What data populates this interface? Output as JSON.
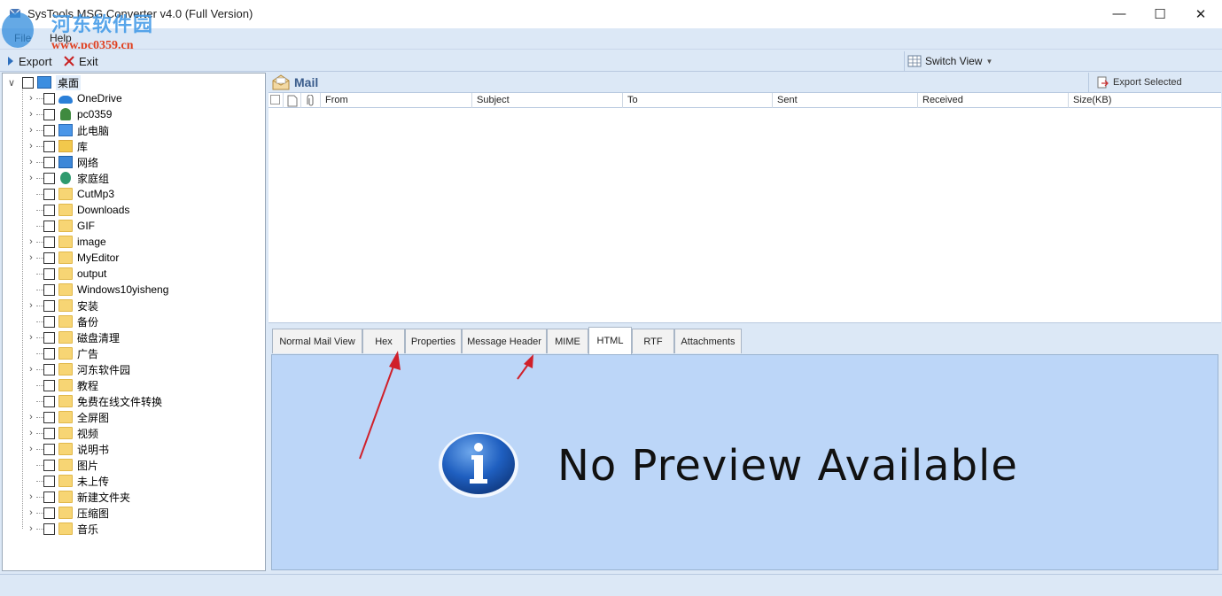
{
  "window": {
    "title": "SysTools MSG Converter v4.0 (Full Version)",
    "minimize": "—",
    "maximize": "☐",
    "close": "✕"
  },
  "watermark": {
    "site_name": "河东软件园",
    "url": "www.pc0359.cn"
  },
  "menu": {
    "file": "File",
    "help": "Help"
  },
  "toolbar": {
    "export": "Export",
    "exit": "Exit",
    "switch_view": "Switch View"
  },
  "tree": {
    "root": "桌面",
    "items": [
      {
        "label": "OneDrive",
        "icon": "onedrive-icon",
        "expandable": true
      },
      {
        "label": "pc0359",
        "icon": "user-icon",
        "expandable": true
      },
      {
        "label": "此电脑",
        "icon": "computer-icon",
        "expandable": true
      },
      {
        "label": "库",
        "icon": "library-icon",
        "expandable": true
      },
      {
        "label": "网络",
        "icon": "network-icon",
        "expandable": true
      },
      {
        "label": "家庭组",
        "icon": "homegroup-icon",
        "expandable": true
      },
      {
        "label": "CutMp3",
        "icon": "folder-icon",
        "expandable": false
      },
      {
        "label": "Downloads",
        "icon": "folder-icon",
        "expandable": false
      },
      {
        "label": "GIF",
        "icon": "folder-icon",
        "expandable": false
      },
      {
        "label": "image",
        "icon": "folder-icon",
        "expandable": true
      },
      {
        "label": "MyEditor",
        "icon": "folder-icon",
        "expandable": true
      },
      {
        "label": "output",
        "icon": "folder-icon",
        "expandable": false
      },
      {
        "label": "Windows10yisheng",
        "icon": "folder-icon",
        "expandable": false
      },
      {
        "label": "安装",
        "icon": "folder-icon",
        "expandable": true
      },
      {
        "label": "备份",
        "icon": "folder-icon",
        "expandable": false
      },
      {
        "label": "磁盘清理",
        "icon": "folder-icon",
        "expandable": true
      },
      {
        "label": "广告",
        "icon": "folder-icon",
        "expandable": false
      },
      {
        "label": "河东软件园",
        "icon": "folder-icon",
        "expandable": true
      },
      {
        "label": "教程",
        "icon": "folder-icon",
        "expandable": false
      },
      {
        "label": "免费在线文件转换",
        "icon": "folder-icon",
        "expandable": false
      },
      {
        "label": "全屏图",
        "icon": "folder-icon",
        "expandable": true
      },
      {
        "label": "视频",
        "icon": "folder-icon",
        "expandable": true
      },
      {
        "label": "说明书",
        "icon": "folder-icon",
        "expandable": true
      },
      {
        "label": "图片",
        "icon": "folder-icon",
        "expandable": false
      },
      {
        "label": "未上传",
        "icon": "folder-icon",
        "expandable": false
      },
      {
        "label": "新建文件夹",
        "icon": "folder-icon",
        "expandable": true
      },
      {
        "label": "压缩图",
        "icon": "folder-icon",
        "expandable": true
      },
      {
        "label": "音乐",
        "icon": "folder-icon",
        "expandable": true
      }
    ]
  },
  "mail": {
    "title": "Mail",
    "export_selected": "Export Selected",
    "columns": [
      "From",
      "Subject",
      "To",
      "Sent",
      "Received",
      "Size(KB)"
    ]
  },
  "tabs": [
    "Normal Mail View",
    "Hex",
    "Properties",
    "Message Header",
    "MIME",
    "HTML",
    "RTF",
    "Attachments"
  ],
  "active_tab": "HTML",
  "preview": {
    "message": "No Preview Available"
  },
  "colors": {
    "accent": "#3a5c8c",
    "preview_bg": "#bcd6f8",
    "chrome_bg": "#dce8f6",
    "arrow": "#d0202a"
  }
}
